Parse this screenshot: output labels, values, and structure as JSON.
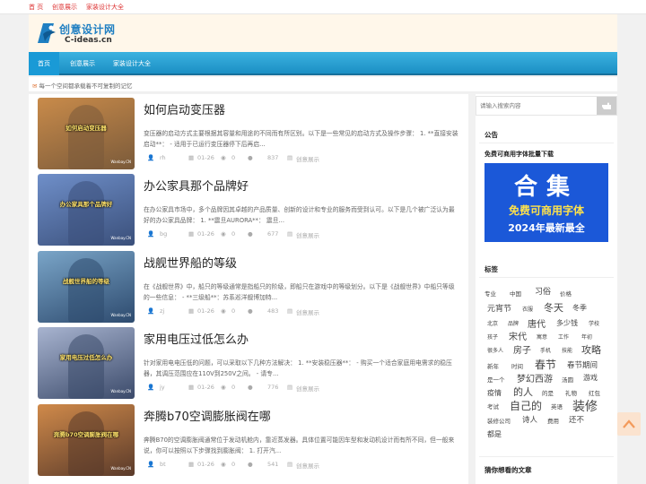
{
  "topbar": {
    "links": [
      "首 页",
      "创意展示",
      "家装设计大全"
    ]
  },
  "logo": {
    "name_cn": "创意设计网",
    "name_en": "C-ideas.cn"
  },
  "nav": {
    "items": [
      "首页",
      "创意展示",
      "家装设计大全"
    ]
  },
  "notice": {
    "icon": "mail-icon",
    "text": "每一个空间都承载着不可复制的记忆"
  },
  "posts": [
    {
      "thumb_caption": "如何启动变压器",
      "thumb_colors": [
        "#7a5a3a",
        "#c98b4a"
      ],
      "title": "如何启动变压器",
      "excerpt": "变压器的启动方式主要根据其容量和用途的不同而有所区别。以下是一些常见的启动方式及操作步骤：  1. **直接安装启动**：  - 适用于已运行变压器停下后再启...",
      "author": "rh",
      "date": "01-26",
      "comments": "0",
      "views": "837",
      "category": "创意展示"
    },
    {
      "thumb_caption": "办公家具那个品牌好",
      "thumb_colors": [
        "#3a4f7a",
        "#6f8fc9"
      ],
      "title": "办公家具那个品牌好",
      "excerpt": "在办公家具市场中，多个品牌因其卓越的产品质量、创新的设计和专业的服务而受到认可。以下是几个被广泛认为最好的办公家具品牌：  1. **震旦AURORA**：  震旦...",
      "author": "bg",
      "date": "01-26",
      "comments": "0",
      "views": "677",
      "category": "创意展示"
    },
    {
      "thumb_caption": "战舰世界船的等级",
      "thumb_colors": [
        "#2d4a6e",
        "#7aa5c8"
      ],
      "title": "战舰世界船的等级",
      "excerpt": "在《战舰世界》中，船只的等级通常是指船只的阶级，即船只在游戏中的等级划分。以下是《战舰世界》中船只等级的一些信息：  - **三级船**：苏系巡洋舰博加特...",
      "author": "zj",
      "date": "01-26",
      "comments": "0",
      "views": "483",
      "category": "创意展示"
    },
    {
      "thumb_caption": "家用电压过低怎么办",
      "thumb_colors": [
        "#3b4a6a",
        "#a8b4d0"
      ],
      "title": "家用电压过低怎么办",
      "excerpt": "针对家用电电压低的问题，可以采取以下几种方法解决：  1. **安装稳压器**：  - 购买一个适合家庭用电需求的稳压器，其调压范围应在110V到250V之间。  - 请专...",
      "author": "jy",
      "date": "01-26",
      "comments": "0",
      "views": "776",
      "category": "创意展示"
    },
    {
      "thumb_caption": "奔腾b70空调膨胀阀在哪",
      "thumb_colors": [
        "#5a3a2a",
        "#d08a4a"
      ],
      "title": "奔腾b70空调膨胀阀在哪",
      "excerpt": "奔腾B70的空调膨胀阀通常位于发动机舱内，靠近蒸发器。具体位置可能因车型和发动机设计而有所不同，但一般来说，你可以按照以下步骤找到膨胀阀：  1. 打开汽...",
      "author": "bt",
      "date": "01-26",
      "comments": "0",
      "views": "541",
      "category": "创意展示"
    }
  ],
  "thumb_brand": "Wanbay.CN",
  "sidebar": {
    "search_placeholder": "请输入搜索内容",
    "announce_title": "公告",
    "announce_link": "免费可商用字体批量下载",
    "ad": {
      "line1": "合集",
      "line2": "免费可商用字体",
      "line3": "2024年最新最全"
    },
    "tags_title": "标签",
    "tags": [
      "专业",
      "中国",
      "习俗",
      "价格",
      "元宵节",
      "衣服",
      "冬天",
      "冬季",
      "北京",
      "品牌",
      "唐代",
      "多少钱",
      "学校",
      "孩子",
      "宋代",
      "寓意",
      "工作",
      "年初",
      "很多人",
      "房子",
      "手机",
      "技能",
      "攻略",
      "新年",
      "时间",
      "春节",
      "春节期间",
      "是一个",
      "梦幻西游",
      "汤圆",
      "游戏",
      "疫情",
      "的人",
      "的是",
      "礼物",
      "红包",
      "考试",
      "自己的",
      "英语",
      "装修",
      "装修公司",
      "诗人",
      "费用",
      "还不",
      "都是"
    ],
    "guess_title": "猜你想看的文章"
  }
}
